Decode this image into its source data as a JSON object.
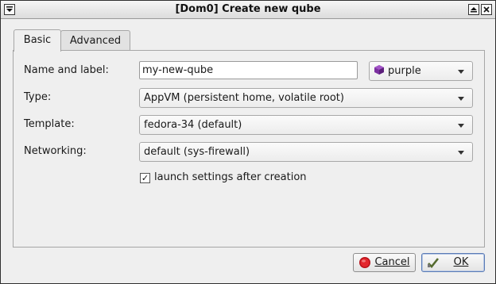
{
  "window": {
    "title": "[Dom0] Create new qube",
    "menu_icon": "window-menu-icon",
    "maximize_icon": "maximize-icon",
    "close_icon": "close-icon"
  },
  "tabs": [
    {
      "label": "Basic",
      "active": true
    },
    {
      "label": "Advanced",
      "active": false
    }
  ],
  "form": {
    "name_label": "Name and label:",
    "name_value": "my-new-qube",
    "color_label": "purple",
    "color_hex": "#7b2fa0",
    "type_label": "Type:",
    "type_value": "AppVM (persistent home, volatile root)",
    "template_label": "Template:",
    "template_value": "fedora-34 (default)",
    "networking_label": "Networking:",
    "networking_value": "default (sys-firewall)",
    "launch_settings_label": "launch settings after creation",
    "launch_settings_checked": true,
    "check_glyph": "✓"
  },
  "buttons": {
    "cancel_label": "Cancel",
    "cancel_icon": "stop-icon",
    "ok_label": "OK",
    "ok_icon": "checkmark-icon"
  }
}
